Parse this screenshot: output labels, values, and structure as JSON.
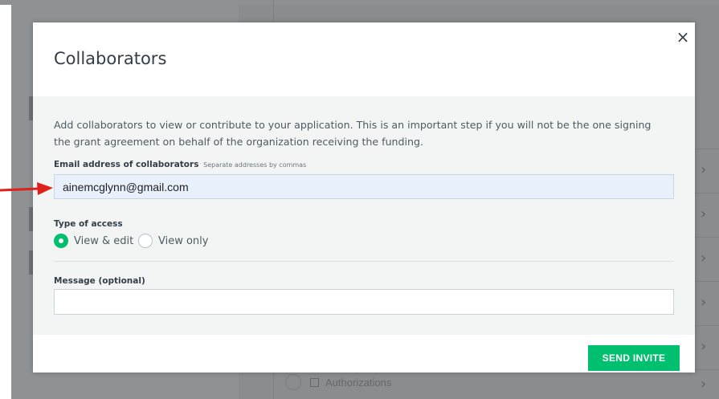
{
  "background": {
    "authorizations_label": "Authorizations"
  },
  "modal": {
    "title": "Collaborators",
    "close_glyph": "×",
    "description": "Add collaborators to view or contribute to your application. This is an important step if you will not be the one signing the grant agreement on behalf of the organization receiving the funding.",
    "email_label": "Email address of collaborators",
    "email_hint": "Separate addresses by commas",
    "email_value": "ainemcglynn@gmail.com",
    "access_label": "Type of access",
    "access_options": [
      {
        "label": "View & edit",
        "selected": true
      },
      {
        "label": "View only",
        "selected": false
      }
    ],
    "message_label": "Message (optional)",
    "message_value": "",
    "send_button": "SEND INVITE"
  },
  "colors": {
    "accent_green": "#00bf6f",
    "annotation_arrow": "#e0201a"
  },
  "icons": [
    "close-icon",
    "radio-selected-icon",
    "radio-unselected-icon",
    "chevron-right-icon",
    "annotation-arrow-icon"
  ]
}
